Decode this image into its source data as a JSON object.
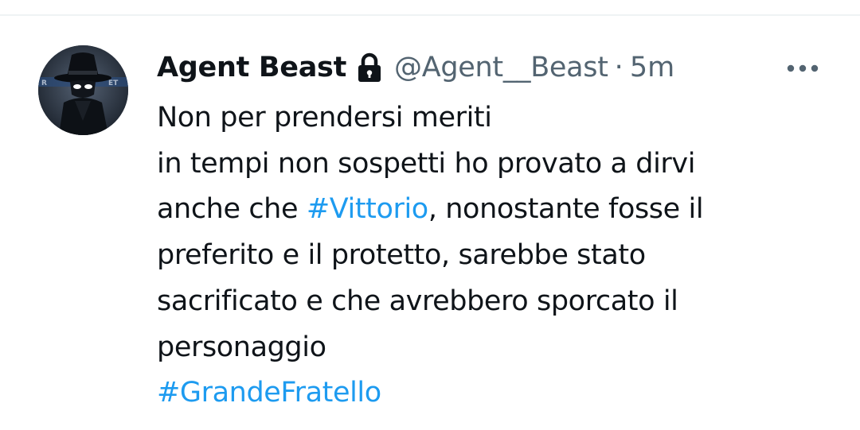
{
  "tweet": {
    "author": {
      "display_name": "Agent Beast",
      "handle": "@Agent__Beast",
      "protected_icon": "lock-icon",
      "avatar_icon": "spy-hat-avatar"
    },
    "separator": "·",
    "timestamp": "5m",
    "more_icon": "more-horizontal-icon",
    "body": {
      "line1": "Non per prendersi meriti",
      "line2": "in tempi non sospetti ho provato a dirvi",
      "line3_prefix": "anche che ",
      "hashtag_vittorio": "#Vittorio",
      "line3_suffix": ", nonostante fosse il",
      "line4": "preferito e il protetto, sarebbe stato",
      "line5": "sacrificato e che avrebbero sporcato il",
      "line6": "personaggio",
      "hashtag_grandefratello": "#GrandeFratello"
    },
    "colors": {
      "text": "#0f1419",
      "secondary": "#536471",
      "link": "#1d9bf0",
      "divider": "#eff3f4"
    }
  }
}
